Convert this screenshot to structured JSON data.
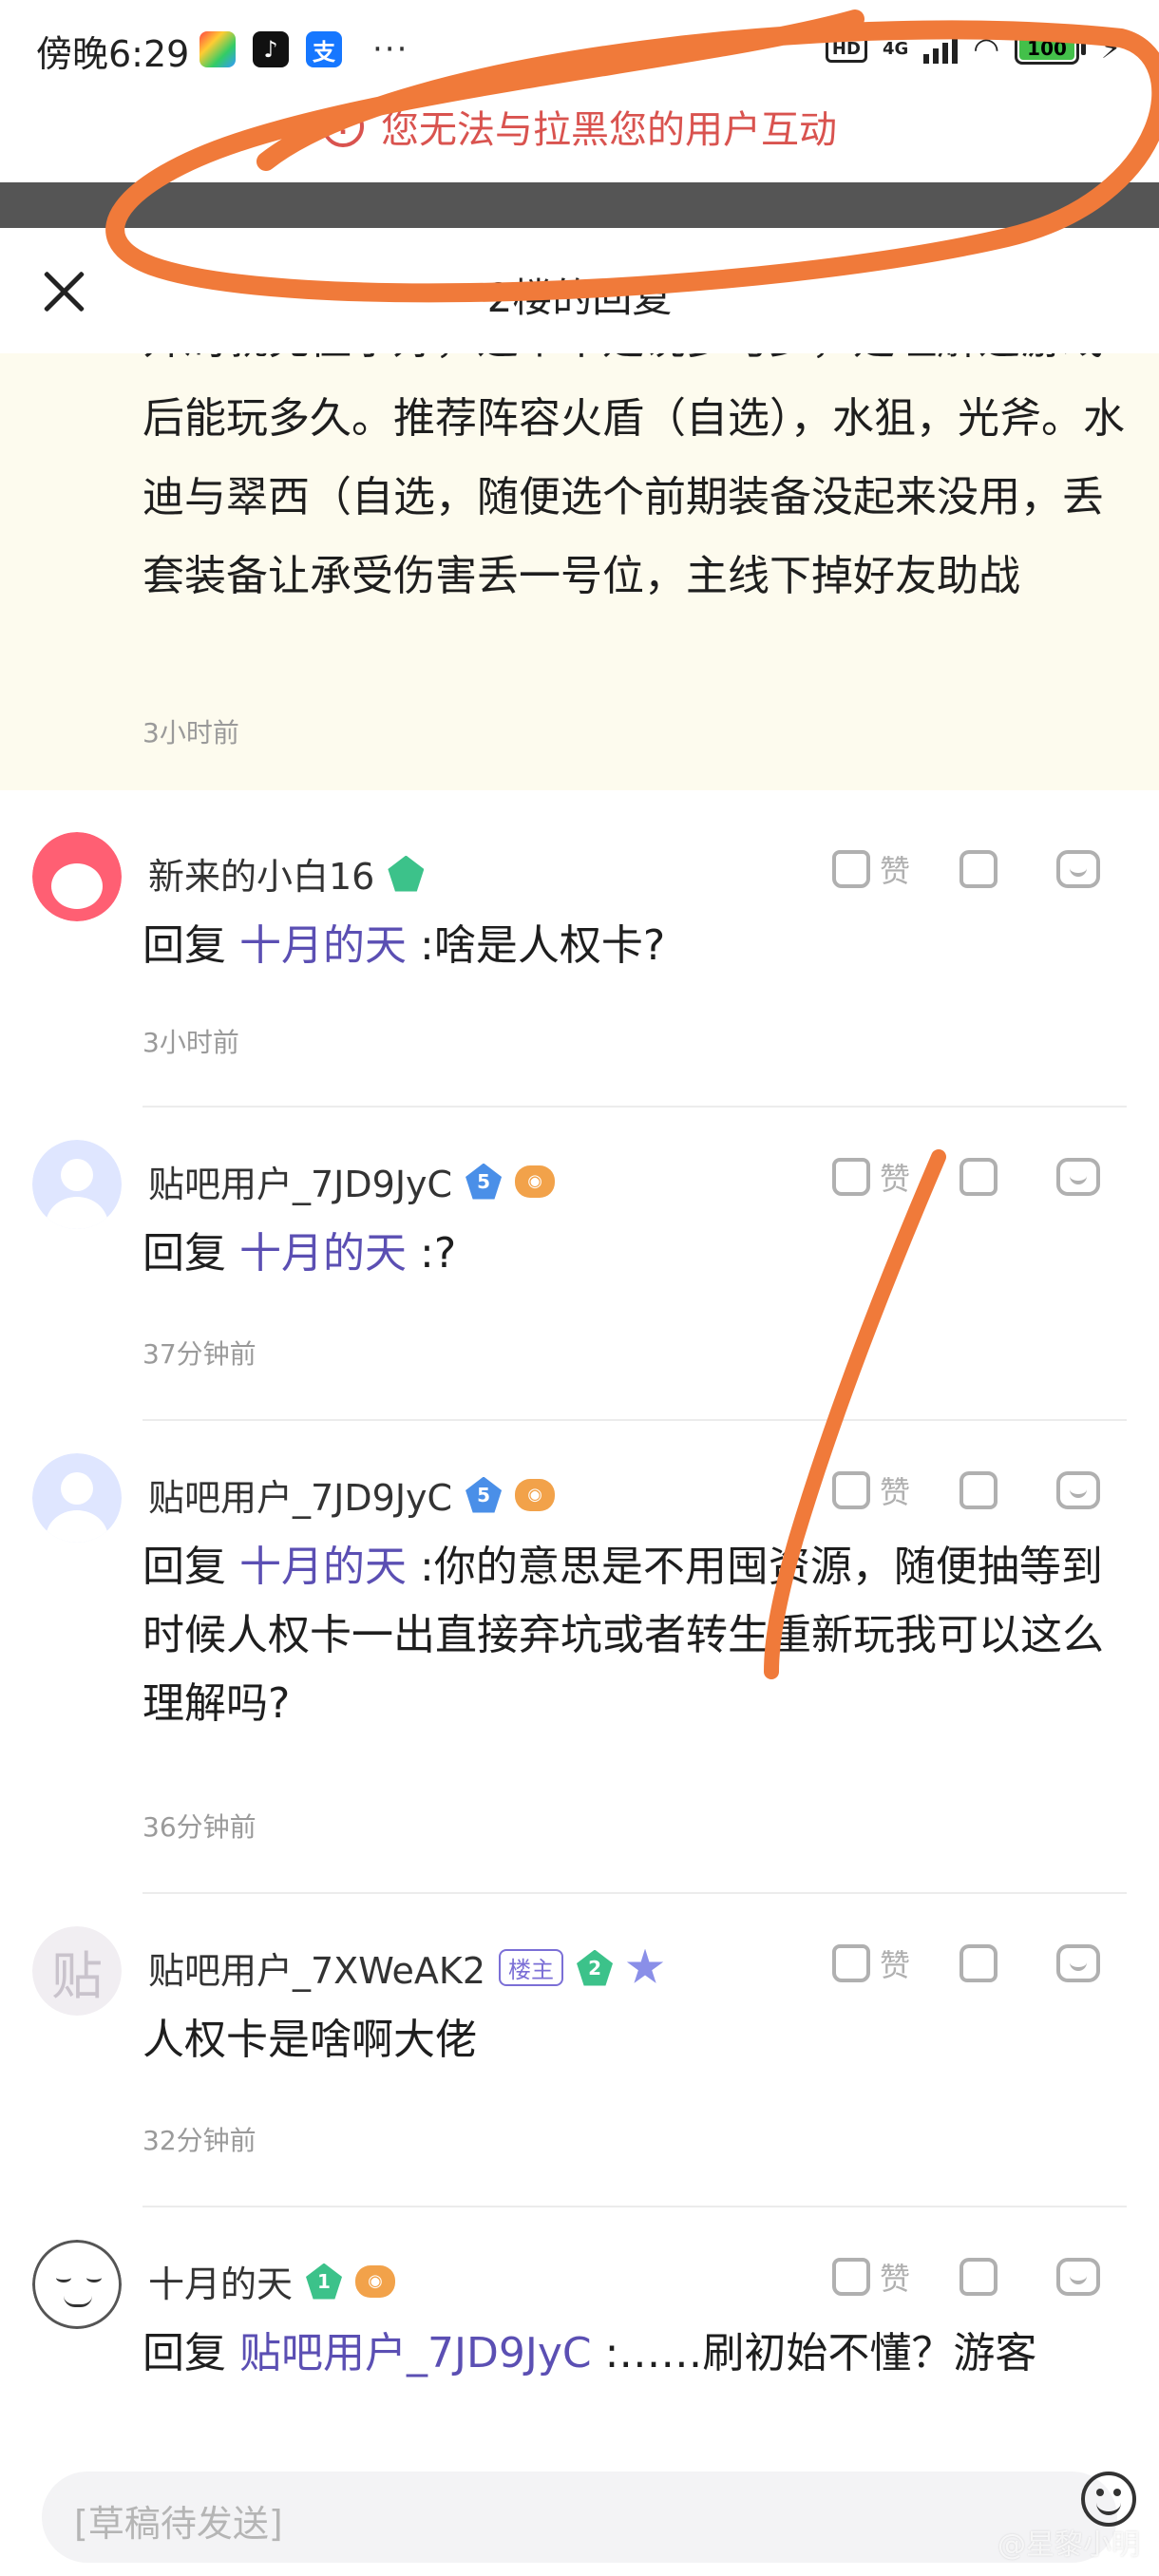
{
  "status_bar": {
    "time": "傍晚6:29",
    "apps": [
      "photos",
      "tiktok",
      "alipay"
    ],
    "more": "···",
    "hd": "HD",
    "network": "4G",
    "battery": "100"
  },
  "toast": {
    "icon": "!",
    "message": "您无法与拉黑您的用户互动"
  },
  "sheet": {
    "title": "2楼的回复"
  },
  "original_post": {
    "text": "开局就充值示好，这个不是说多与少，是理解这游戏后能玩多久。推荐阵容火盾（自选），水狙，光斧。水迪与翠西（自选，随便选个前期装备没起来没用，丢套装备让承受伤害丢一号位，主线下掉好友助战",
    "time": "3小时前"
  },
  "like_label": "赞",
  "comments": [
    {
      "username": "新来的小白16",
      "level": "",
      "gem_color": "#3cc28a",
      "host_badge": "",
      "extra_badge": "",
      "prefix": "回复",
      "mention": "十月的天",
      "text": ":啥是人权卡?",
      "time": "3小时前",
      "avatar": "rabbit"
    },
    {
      "username": "贴吧用户_7JD9JyC",
      "level": "5",
      "gem_color": "#4a8fe8",
      "host_badge": "",
      "extra_badge": "game",
      "prefix": "回复",
      "mention": "十月的天",
      "text": ":?",
      "time": "37分钟前",
      "avatar": "default"
    },
    {
      "username": "贴吧用户_7JD9JyC",
      "level": "5",
      "gem_color": "#4a8fe8",
      "host_badge": "",
      "extra_badge": "game",
      "prefix": "回复",
      "mention": "十月的天",
      "text": ":你的意思是不用囤资源，随便抽等到时候人权卡一出直接弃坑或者转生重新玩我可以这么理解吗?",
      "time": "36分钟前",
      "avatar": "default"
    },
    {
      "username": "贴吧用户_7XWeAK2",
      "level": "2",
      "gem_color": "#3cc28a",
      "host_badge": "楼主",
      "extra_badge": "star",
      "prefix": "",
      "mention": "",
      "text": "人权卡是啥啊大佬",
      "time": "32分钟前",
      "avatar": "tieba"
    },
    {
      "username": "十月的天",
      "level": "1",
      "gem_color": "#3cc28a",
      "host_badge": "",
      "extra_badge": "game",
      "prefix": "回复",
      "mention": "贴吧用户_7JD9JyC",
      "text": ":……刷初始不懂？游客",
      "time": "",
      "avatar": "drawn"
    }
  ],
  "tieba_avatar_char": "贴",
  "input": {
    "placeholder": "[草稿待发送]"
  },
  "watermark": "@星黎小明",
  "colors": {
    "accent_purple": "#5b4fb3",
    "warning_red": "#d9534f",
    "marker_orange": "#f07a3a",
    "highlight_bg": "#fdfbee"
  }
}
